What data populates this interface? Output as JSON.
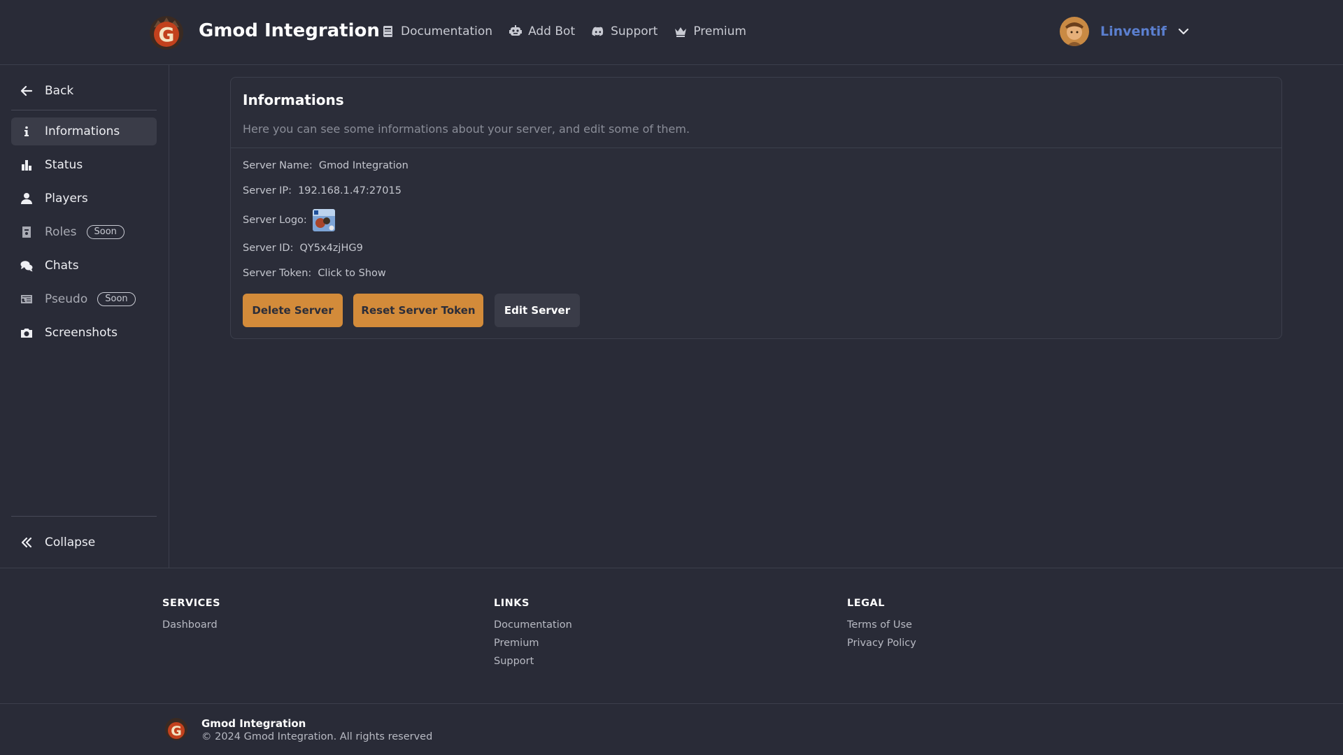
{
  "app": {
    "brand": "Gmod Integration",
    "logo_icon": "gmod-integration-logo"
  },
  "nav": {
    "links": [
      {
        "label": "Documentation",
        "icon": "book-icon"
      },
      {
        "label": "Add Bot",
        "icon": "robot-icon"
      },
      {
        "label": "Support",
        "icon": "discord-icon"
      },
      {
        "label": "Premium",
        "icon": "crown-icon"
      }
    ],
    "user": {
      "name": "Linventif",
      "name_color": "#5b7fcf"
    }
  },
  "sidebar": {
    "back": "Back",
    "items": [
      {
        "label": "Informations",
        "icon": "info-icon",
        "active": true
      },
      {
        "label": "Status",
        "icon": "bar-chart-icon"
      },
      {
        "label": "Players",
        "icon": "user-icon"
      },
      {
        "label": "Roles",
        "icon": "id-badge-icon",
        "badge": "Soon"
      },
      {
        "label": "Chats",
        "icon": "chat-bubbles-icon"
      },
      {
        "label": "Pseudo",
        "icon": "id-card-icon",
        "badge": "Soon"
      },
      {
        "label": "Screenshots",
        "icon": "camera-icon"
      }
    ],
    "collapse": "Collapse"
  },
  "card": {
    "title": "Informations",
    "subtitle": "Here you can see some informations about your server, and edit some of them.",
    "fields": {
      "name_label": "Server Name:",
      "name_value": "Gmod Integration",
      "ip_label": "Server IP:",
      "ip_value": "192.168.1.47:27015",
      "logo_label": "Server Logo:",
      "id_label": "Server ID:",
      "id_value": "QY5x4zjHG9",
      "token_label": "Server Token:",
      "token_value": "Click to Show"
    },
    "buttons": {
      "delete": "Delete Server",
      "reset": "Reset Server Token",
      "edit": "Edit Server"
    }
  },
  "footer": {
    "services": {
      "title": "SERVICES",
      "links": [
        "Dashboard"
      ]
    },
    "links": {
      "title": "LINKS",
      "links": [
        "Documentation",
        "Premium",
        "Support"
      ]
    },
    "legal": {
      "title": "LEGAL",
      "links": [
        "Terms of Use",
        "Privacy Policy"
      ]
    },
    "brand": "Gmod Integration",
    "copyright": "© 2024 Gmod Integration. All rights reserved"
  },
  "colors": {
    "background": "#292b37",
    "accent_orange": "#d38b3a",
    "user_blue": "#5b7fcf"
  }
}
